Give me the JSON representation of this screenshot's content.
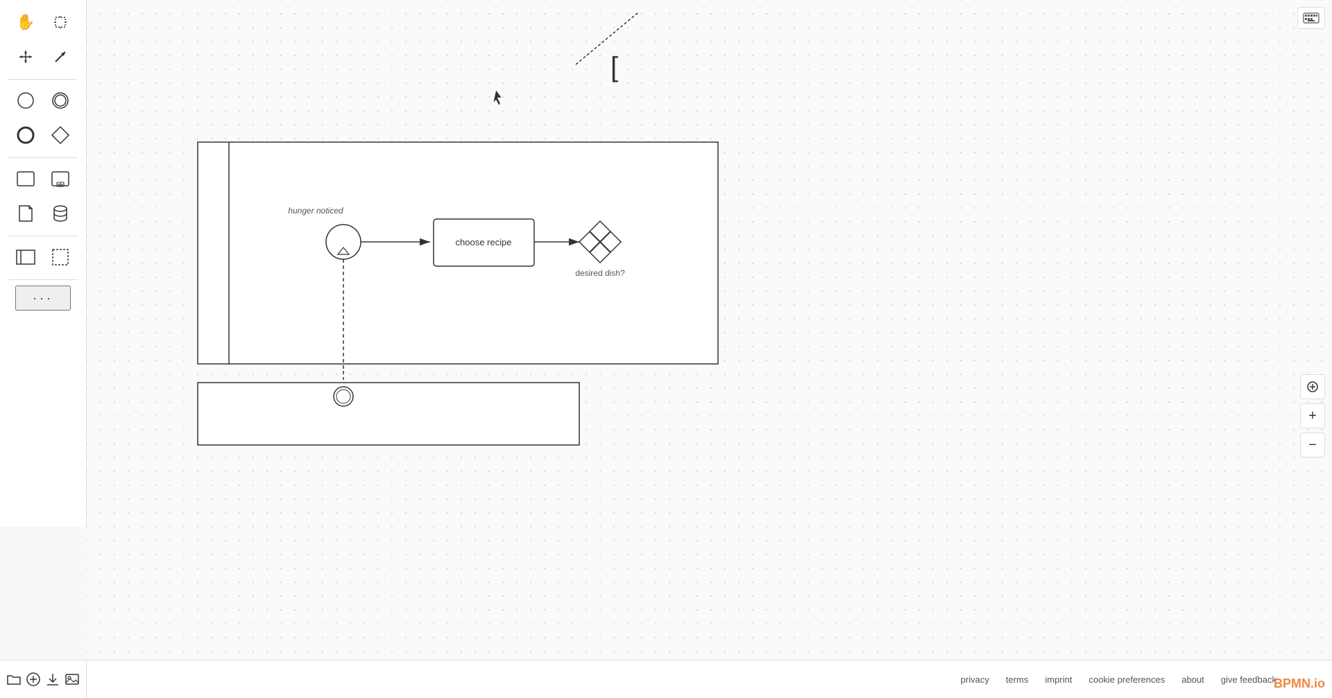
{
  "toolbar": {
    "tools": [
      {
        "name": "hand-tool",
        "icon": "✋",
        "label": "Hand"
      },
      {
        "name": "select-tool",
        "icon": "⊹",
        "label": "Select"
      },
      {
        "name": "move-tool",
        "icon": "✛",
        "label": "Move"
      },
      {
        "name": "arrow-tool",
        "icon": "↗",
        "label": "Arrow"
      },
      {
        "name": "start-event",
        "icon": "○",
        "label": "Start Event"
      },
      {
        "name": "intermediate-event",
        "icon": "◎",
        "label": "Intermediate Event"
      },
      {
        "name": "end-event",
        "icon": "●",
        "label": "End Event"
      },
      {
        "name": "gateway",
        "icon": "◇",
        "label": "Gateway"
      },
      {
        "name": "task",
        "icon": "□",
        "label": "Task"
      },
      {
        "name": "subprocess",
        "icon": "▣",
        "label": "Subprocess"
      },
      {
        "name": "document",
        "icon": "📄",
        "label": "Document"
      },
      {
        "name": "database",
        "icon": "🗄",
        "label": "Database"
      },
      {
        "name": "lane",
        "icon": "▬",
        "label": "Lane"
      },
      {
        "name": "selection",
        "icon": "⬚",
        "label": "Selection"
      },
      {
        "name": "more",
        "icon": "···",
        "label": "More"
      }
    ]
  },
  "bottom_toolbar": {
    "buttons": [
      {
        "name": "folder-btn",
        "icon": "📁",
        "label": "Open"
      },
      {
        "name": "add-btn",
        "icon": "⊕",
        "label": "Add"
      },
      {
        "name": "download-btn",
        "icon": "⬇",
        "label": "Download"
      },
      {
        "name": "image-btn",
        "icon": "🖼",
        "label": "Image"
      }
    ]
  },
  "diagram": {
    "choose_recipe_label": "choose recipe",
    "hunger_noticed_label": "hunger noticed",
    "desired_dish_label": "desired dish?"
  },
  "footer": {
    "links": [
      {
        "name": "privacy-link",
        "label": "privacy"
      },
      {
        "name": "terms-link",
        "label": "terms"
      },
      {
        "name": "imprint-link",
        "label": "imprint"
      },
      {
        "name": "cookie-preferences-link",
        "label": "cookie preferences"
      },
      {
        "name": "about-link",
        "label": "about"
      },
      {
        "name": "give-feedback-link",
        "label": "give feedback"
      }
    ],
    "logo": "BPMN.io"
  },
  "zoom": {
    "fit-icon": "⊕",
    "plus-icon": "+",
    "minus-icon": "−"
  },
  "keyboard_icon": "⌨"
}
